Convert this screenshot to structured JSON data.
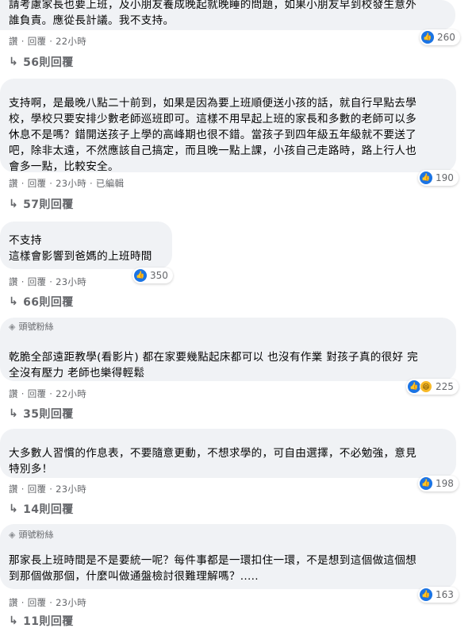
{
  "comments": [
    {
      "text": "請考慮家長也要上班，及小朋友養成晚起就晚睡的問題，如果小朋友早到校發生意外\n誰負責。應從長計議。我不支持。",
      "actions": [
        "讚",
        "回覆",
        "22小時"
      ],
      "reaction_count": "260",
      "replies": "56則回覆"
    },
    {
      "text": "支持啊，是最晚八點二十前到，如果是因為要上班順便送小孩的話，就自行早點去學\n校，學校只要安排少數老師巡班即可。這樣不用早起上班的家長和多數的老師可以多\n休息不是嗎？錯開送孩子上學的高峰期也很不錯。當孩子到四年級五年級就不要送了\n吧，除非太遠，不然應該自己搞定，而且晚一點上課，小孩自己走路時，路上行人也\n會多一點，比較安全。",
      "actions": [
        "讚",
        "回覆",
        "23小時",
        "已編輯"
      ],
      "reaction_count": "190",
      "replies": "57則回覆"
    },
    {
      "text": "不支持\n這樣會影響到爸媽的上班時間",
      "actions": [
        "讚",
        "回覆",
        "23小時"
      ],
      "reaction_count": "350",
      "replies": "66則回覆"
    },
    {
      "badge": "頭號粉絲",
      "text": "乾脆全部遠距教學(看影片) 都在家要幾點起床都可以 也沒有作業 對孩子真的很好 完\n全沒有壓力 老師也樂得輕鬆",
      "actions": [
        "讚",
        "回覆",
        "22小時"
      ],
      "reaction_count": "225",
      "replies": "35則回覆"
    },
    {
      "text": "大多數人習慣的作息表，不要隨意更動，不想求學的，可自由選擇，不必勉強，意見\n特別多！",
      "actions": [
        "讚",
        "回覆",
        "23小時"
      ],
      "reaction_count": "198",
      "replies": "14則回覆"
    },
    {
      "badge": "頭號粉絲",
      "text": "那家長上班時間是不是要統一呢？每件事都是一環扣住一環，不是想到這個做這個想\n到那個做那個，什麼叫做通盤檢討很難理解嗎？.....",
      "actions": [
        "讚",
        "回覆",
        "23小時"
      ],
      "reaction_count": "163",
      "replies": "11則回覆"
    }
  ],
  "icons": {
    "like": "thumbs-up-icon",
    "haha": "laughing-emoji-icon",
    "reply": "reply-arrow-icon",
    "badge": "diamond-icon"
  },
  "colors": {
    "bubble": "#f0f2f5",
    "like": "#1b74e4",
    "meta": "#65676b"
  }
}
